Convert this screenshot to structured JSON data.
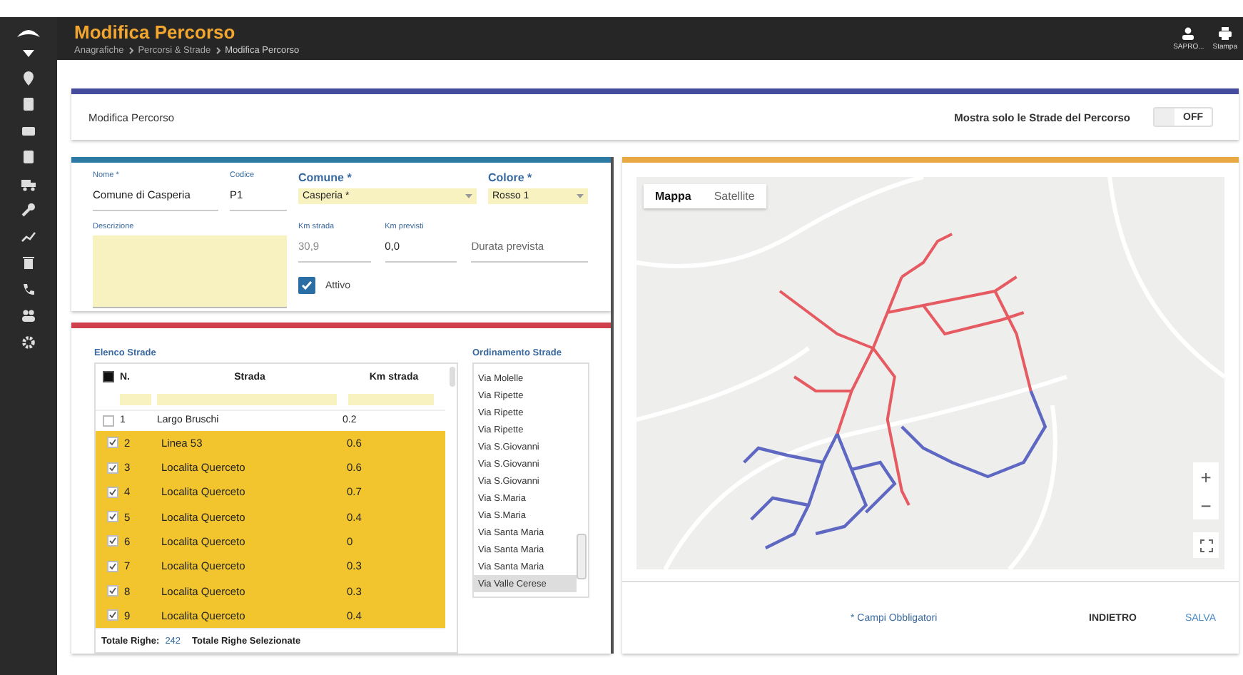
{
  "header": {
    "title": "Modifica Percorso",
    "breadcrumb": [
      "Anagrafiche",
      "Percorsi & Strade",
      "Modifica Percorso"
    ],
    "user_label": "SAPRO...",
    "print_label": "Stampa"
  },
  "toolbar": {
    "title": "Modifica Percorso",
    "toggle_label": "Mostra solo le Strade del Percorso",
    "toggle": {
      "on": false,
      "text": "OFF"
    }
  },
  "form": {
    "nome": {
      "label": "Nome *",
      "value": "Comune di Casperia"
    },
    "codice": {
      "label": "Codice",
      "value": "P1"
    },
    "comune": {
      "label": "Comune *",
      "value": "Casperia *"
    },
    "colore": {
      "label": "Colore *",
      "value": "Rosso 1"
    },
    "descrizione": {
      "label": "Descrizione"
    },
    "km_strada": {
      "label": "Km strada",
      "value": "30,9",
      "disabled": true
    },
    "km_previsti": {
      "label": "Km previsti",
      "value": "0,0",
      "disabled": false
    },
    "durata": {
      "placeholder": "Durata prevista"
    },
    "attivo": {
      "label": "Attivo",
      "checked": true
    }
  },
  "strade": {
    "title": "Elenco Strade",
    "columns": [
      "N.",
      "Strada",
      "Km strada"
    ],
    "all_checked": true,
    "rows": [
      {
        "n": "1",
        "strada": "Largo Bruschi",
        "km": "0.2",
        "selected": false
      },
      {
        "n": "2",
        "strada": "Linea 53",
        "km": "0.6",
        "selected": true
      },
      {
        "n": "3",
        "strada": "Localita Querceto",
        "km": "0.6",
        "selected": true
      },
      {
        "n": "4",
        "strada": "Localita Querceto",
        "km": "0.7",
        "selected": true
      },
      {
        "n": "5",
        "strada": "Localita Querceto",
        "km": "0.4",
        "selected": true
      },
      {
        "n": "6",
        "strada": "Localita Querceto",
        "km": "0",
        "selected": true
      },
      {
        "n": "7",
        "strada": "Localita Querceto",
        "km": "0.3",
        "selected": true
      },
      {
        "n": "8",
        "strada": "Localita Querceto",
        "km": "0.3",
        "selected": true
      },
      {
        "n": "9",
        "strada": "Localita Querceto",
        "km": "0.4",
        "selected": true
      }
    ],
    "total_label": "Totale Righe:",
    "total_value": "242",
    "selected_label": "Totale Righe Selezionate"
  },
  "ordinamento": {
    "title": "Ordinamento Strade",
    "items": [
      {
        "label": "Via Molelle",
        "selected": false
      },
      {
        "label": "Via Ripette",
        "selected": false
      },
      {
        "label": "Via Ripette",
        "selected": false
      },
      {
        "label": "Via Ripette",
        "selected": false
      },
      {
        "label": "Via S.Giovanni",
        "selected": false
      },
      {
        "label": "Via S.Giovanni",
        "selected": false
      },
      {
        "label": "Via S.Giovanni",
        "selected": false
      },
      {
        "label": "Via S.Maria",
        "selected": false
      },
      {
        "label": "Via S.Maria",
        "selected": false
      },
      {
        "label": "Via Santa Maria",
        "selected": false
      },
      {
        "label": "Via Santa Maria",
        "selected": false
      },
      {
        "label": "Via Santa Maria",
        "selected": false
      },
      {
        "label": "Via Valle Cerese",
        "selected": true
      }
    ]
  },
  "map": {
    "tabs": [
      {
        "label": "Mappa",
        "selected": true
      },
      {
        "label": "Satellite",
        "selected": false
      }
    ],
    "zoom_in": "+",
    "zoom_out": "−"
  },
  "footer": {
    "note": "* Campi Obbligatori",
    "buttons": [
      {
        "label": "INDIETRO",
        "kind": "secondary"
      },
      {
        "label": "SALVA",
        "kind": "primary"
      }
    ]
  }
}
